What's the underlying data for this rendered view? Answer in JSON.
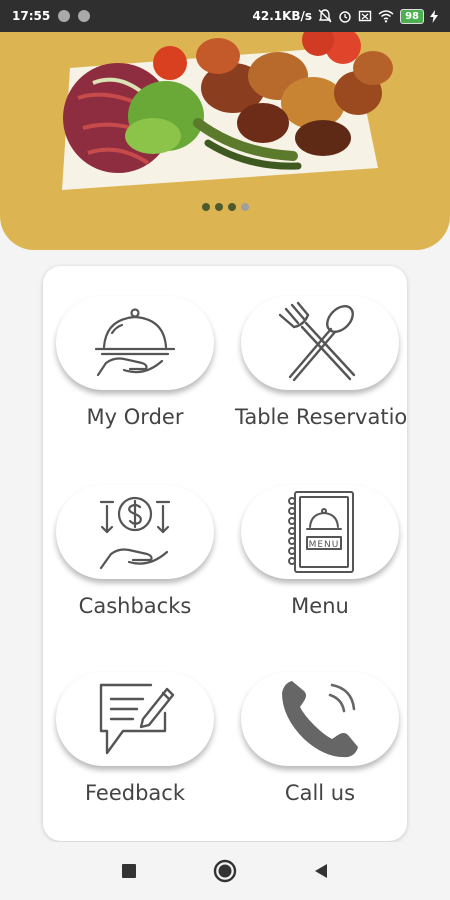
{
  "status_bar": {
    "time": "17:55",
    "network_speed": "42.1KB/s",
    "battery": "98"
  },
  "hero": {
    "image": "grilled-kebab-plate",
    "carousel": {
      "total": 4,
      "active": 3
    },
    "accent_color": "#dcb552"
  },
  "menu": {
    "items": [
      {
        "label": "My Order",
        "icon": "cloche-hand-icon"
      },
      {
        "label": "Table Reservatio",
        "icon": "fork-spoon-icon"
      },
      {
        "label": "Cashbacks",
        "icon": "dollar-coin-hand-icon"
      },
      {
        "label": "Menu",
        "icon": "menu-book-icon"
      },
      {
        "label": "Feedback",
        "icon": "feedback-pen-icon"
      },
      {
        "label": "Call us",
        "icon": "phone-icon"
      }
    ]
  },
  "nav": {
    "buttons": [
      "recents-square-icon",
      "home-circle-icon",
      "back-triangle-icon"
    ]
  }
}
